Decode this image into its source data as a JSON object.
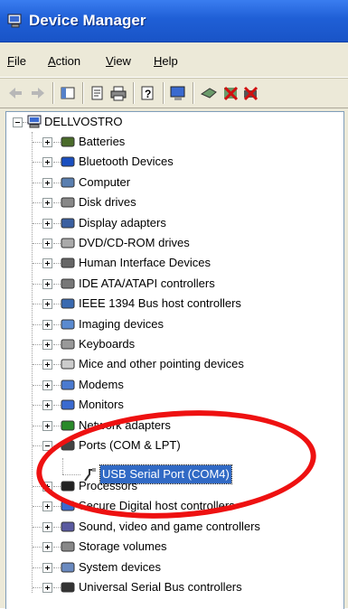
{
  "window": {
    "title": "Device Manager"
  },
  "menu": [
    {
      "label_u": "F",
      "label_rest": "ile"
    },
    {
      "label_u": "A",
      "label_rest": "ction"
    },
    {
      "label_u": "V",
      "label_rest": "iew"
    },
    {
      "label_u": "H",
      "label_rest": "elp"
    }
  ],
  "toolbar": {
    "icons": [
      "back-icon",
      "forward-icon",
      "show-hide-console-tree-icon",
      "properties-icon",
      "print-icon",
      "help-icon",
      "scan-hardware-icon",
      "update-driver-icon",
      "uninstall-icon",
      "disable-icon"
    ]
  },
  "tree": {
    "root": "DELLVOSTRO",
    "categories": [
      "Batteries",
      "Bluetooth Devices",
      "Computer",
      "Disk drives",
      "Display adapters",
      "DVD/CD-ROM drives",
      "Human Interface Devices",
      "IDE ATA/ATAPI controllers",
      "IEEE 1394 Bus host controllers",
      "Imaging devices",
      "Keyboards",
      "Mice and other pointing devices",
      "Modems",
      "Monitors",
      "Network adapters",
      "Ports (COM & LPT)",
      "Processors",
      "Secure Digital host controllers",
      "Sound, video and game controllers",
      "Storage volumes",
      "System devices",
      "Universal Serial Bus controllers"
    ],
    "ports_child": "USB Serial Port (COM4)"
  },
  "colors": {
    "selection": "#316ac5",
    "annotation_circle": "#ee1111",
    "titlebar": "#1f5fd6"
  }
}
